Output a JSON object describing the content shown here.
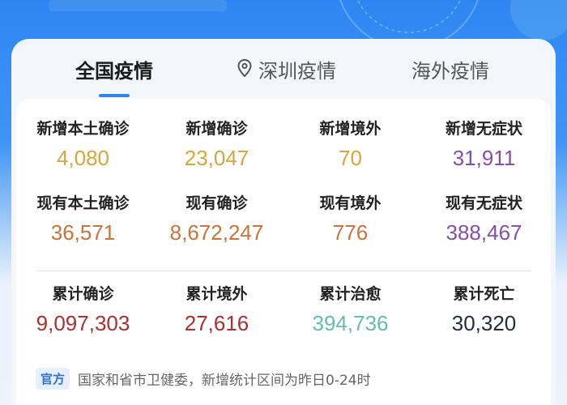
{
  "colors": {
    "header_blue": "#2f86f2",
    "orange": "#d9a53b",
    "purple": "#8a4da8",
    "red": "#a8302e",
    "teal": "#63bdb4",
    "dark": "#1f2d3d",
    "accent_underline": "#2f86f2"
  },
  "tabs": [
    {
      "label": "全国疫情",
      "active": true
    },
    {
      "label": "深圳疫情",
      "icon": "location-pin-icon",
      "active": false
    },
    {
      "label": "海外疫情",
      "active": false
    }
  ],
  "rows": [
    [
      {
        "label": "新增本土确诊",
        "value": "4,080",
        "color": "#d9a53b"
      },
      {
        "label": "新增确诊",
        "value": "23,047",
        "color": "#d9a53b"
      },
      {
        "label": "新增境外",
        "value": "70",
        "color": "#d9a53b"
      },
      {
        "label": "新增无症状",
        "value": "31,911",
        "color": "#8a4da8"
      }
    ],
    [
      {
        "label": "现有本土确诊",
        "value": "36,571",
        "color": "#c9743a"
      },
      {
        "label": "现有确诊",
        "value": "8,672,247",
        "color": "#c9743a"
      },
      {
        "label": "现有境外",
        "value": "776",
        "color": "#c9743a"
      },
      {
        "label": "现有无症状",
        "value": "388,467",
        "color": "#8a4da8"
      }
    ],
    [
      {
        "label": "累计确诊",
        "value": "9,097,303",
        "color": "#a8302e"
      },
      {
        "label": "累计境外",
        "value": "27,616",
        "color": "#a8302e"
      },
      {
        "label": "累计治愈",
        "value": "394,736",
        "color": "#63bdb4"
      },
      {
        "label": "累计死亡",
        "value": "30,320",
        "color": "#1f2d3d"
      }
    ]
  ],
  "note": {
    "badge": "官方",
    "text": "国家和省市卫健委，新增统计区间为昨日0-24时"
  }
}
